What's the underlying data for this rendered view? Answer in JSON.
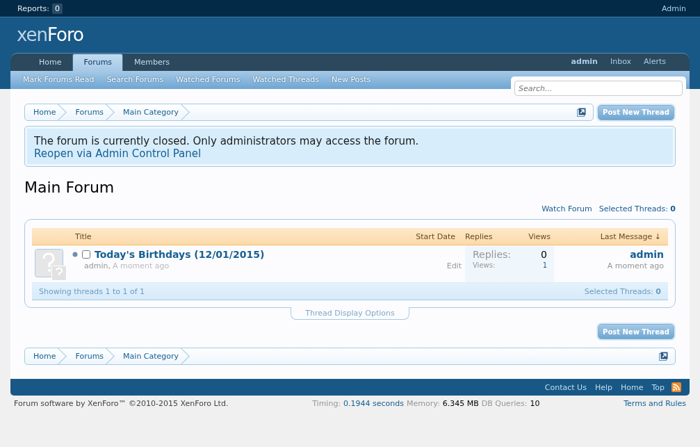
{
  "top_bar": {
    "reports_label": "Reports:",
    "reports_count": "0",
    "user": "Admin"
  },
  "logo": {
    "part1": "xen",
    "part2": "Foro"
  },
  "tabs": [
    {
      "label": "Home",
      "selected": false
    },
    {
      "label": "Forums",
      "selected": true
    },
    {
      "label": "Members",
      "selected": false
    }
  ],
  "account_links": [
    "admin",
    "Inbox",
    "Alerts"
  ],
  "sub_nav": [
    "Mark Forums Read",
    "Search Forums",
    "Watched Forums",
    "Watched Threads",
    "New Posts"
  ],
  "search": {
    "placeholder": "Search..."
  },
  "breadcrumbs_top": [
    "Home",
    "Forums",
    "Main Category"
  ],
  "post_button": "Post New Thread",
  "notice": {
    "message": "The forum is currently closed. Only administrators may access the forum.",
    "link": "Reopen via Admin Control Panel"
  },
  "page_title": "Main Forum",
  "forum_links": {
    "watch": "Watch Forum",
    "selected_label": "Selected Threads:",
    "selected_count": "0"
  },
  "table": {
    "columns": [
      "Title",
      "Start Date",
      "Replies",
      "Views",
      "Last Message ↓"
    ],
    "rows": [
      {
        "title": "Today's Birthdays (12/01/2015)",
        "author": "admin,",
        "time": "A moment ago",
        "edit": "Edit",
        "checked": false,
        "replies_label": "Replies:",
        "replies": "0",
        "views_label": "Views:",
        "views": "1",
        "last_user": "admin",
        "last_time": "A moment ago"
      }
    ],
    "footer_left": "Showing threads 1 to 1 of 1",
    "footer_right_label": "Selected Threads:",
    "footer_right_count": "0"
  },
  "display_options": "Thread Display Options",
  "post_button_bottom": "Post New Thread",
  "breadcrumbs_bottom": [
    "Home",
    "Forums",
    "Main Category"
  ],
  "footer_links": [
    "Contact Us",
    "Help",
    "Home",
    "Top"
  ],
  "copyright": "Forum software by XenForo™ ©2010-2015 XenForo Ltd.",
  "debug": [
    {
      "label": "Timing:",
      "value": "0.1944 seconds",
      "kind": "link"
    },
    {
      "label": "Memory:",
      "value": "6.345 MB",
      "kind": "plain"
    },
    {
      "label": "DB Queries:",
      "value": "10",
      "kind": "plain"
    }
  ],
  "terms": "Terms and Rules"
}
